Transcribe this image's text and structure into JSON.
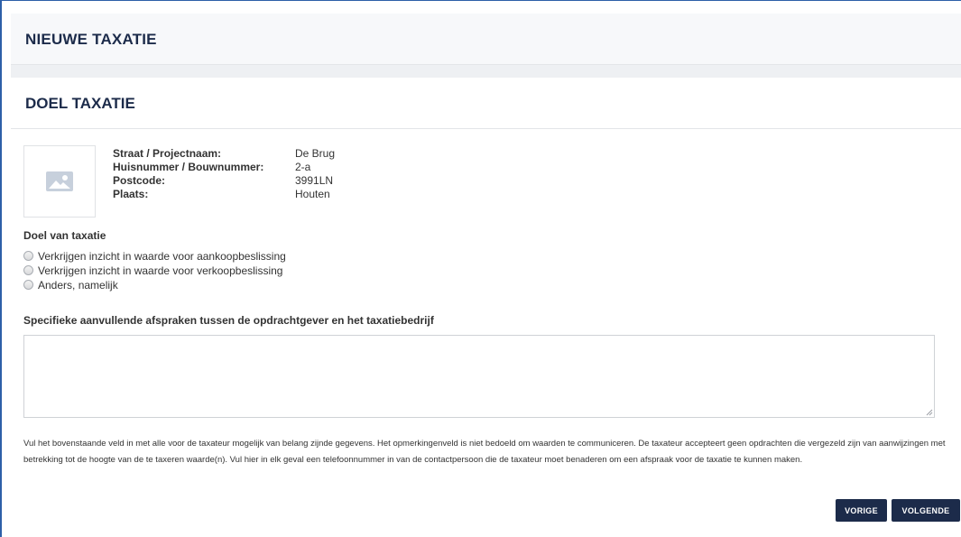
{
  "header": {
    "title": "NIEUWE TAXATIE"
  },
  "section": {
    "title": "DOEL TAXATIE"
  },
  "property": {
    "image_icon": "image-placeholder-icon",
    "rows": [
      {
        "label": "Straat / Projectnaam:",
        "value": "De Brug"
      },
      {
        "label": "Huisnummer / Bouwnummer:",
        "value": "2-a"
      },
      {
        "label": "Postcode:",
        "value": "3991LN"
      },
      {
        "label": "Plaats:",
        "value": "Houten"
      }
    ]
  },
  "doel": {
    "label": "Doel van taxatie",
    "options": [
      {
        "label": "Verkrijgen inzicht in waarde voor aankoopbeslissing",
        "selected": false
      },
      {
        "label": "Verkrijgen inzicht in waarde voor verkoopbeslissing",
        "selected": false
      },
      {
        "label": "Anders, namelijk",
        "selected": false
      }
    ]
  },
  "afspraken": {
    "label": "Specifieke aanvullende afspraken tussen de opdrachtgever en het taxatiebedrijf",
    "value": "",
    "placeholder": ""
  },
  "notice": "Vul het bovenstaande veld in met alle voor de taxateur mogelijk van belang zijnde gegevens. Het opmerkingenveld is niet bedoeld om waarden te communiceren. De taxateur accepteert geen opdrachten die vergezeld zijn van aanwijzingen met betrekking tot de hoogte van de te taxeren waarde(n). Vul hier in elk geval een telefoonnummer in van de contactpersoon die de taxateur moet benaderen om een afspraak voor de taxatie te kunnen maken.",
  "buttons": {
    "prev_label": "VORIGE",
    "next_label": "VOLGENDE"
  },
  "colors": {
    "accent": "#1c2b4a",
    "frame_border": "#2d5fa8",
    "icon": "#c7d0dc"
  }
}
